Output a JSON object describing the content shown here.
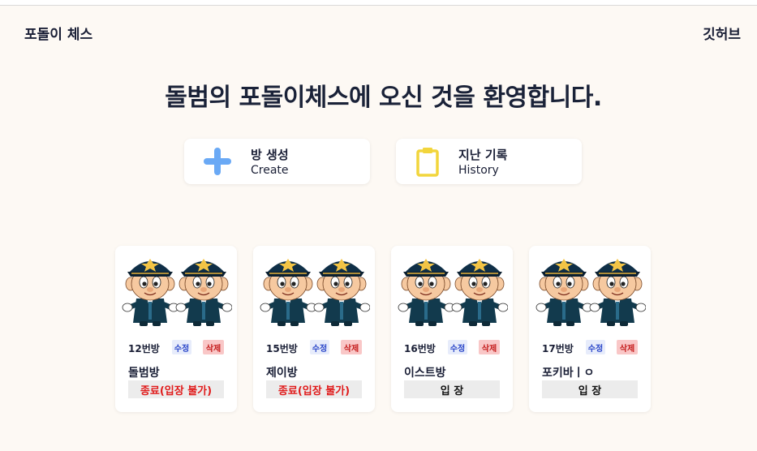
{
  "header": {
    "title": "포돌이 체스",
    "github_link": "깃허브"
  },
  "welcome": "돌범의 포돌이체스에 오신 것을 환영합니다.",
  "actions": {
    "create": {
      "label_ko": "방 생성",
      "label_en": "Create",
      "icon": "plus-icon",
      "color": "#6aa9f5"
    },
    "history": {
      "label_ko": "지난 기록",
      "label_en": "History",
      "icon": "clipboard-icon",
      "color": "#f2d53c"
    }
  },
  "rooms": [
    {
      "number": "12번방",
      "edit": "수정",
      "delete": "삭제",
      "name": "돌범방",
      "status": "종료(입장 불가)"
    },
    {
      "number": "15번방",
      "edit": "수정",
      "delete": "삭제",
      "name": "제이방",
      "status": "종료(입장 불가)"
    },
    {
      "number": "16번방",
      "edit": "수정",
      "delete": "삭제",
      "name": "이스트방",
      "status": "입 장"
    },
    {
      "number": "17번방",
      "edit": "수정",
      "delete": "삭제",
      "name": "포키바ㅣㅇ",
      "status": "입 장"
    }
  ],
  "colors": {
    "background": "#fdf9f4",
    "text": "#1a1f36",
    "closed": "#e01b1b",
    "edit_badge": "#e7ecfb",
    "delete_badge": "#f9c7c7"
  }
}
